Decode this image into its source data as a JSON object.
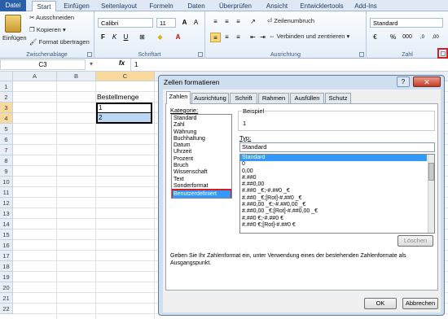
{
  "tabs": [
    "Datei",
    "Start",
    "Einfügen",
    "Seitenlayout",
    "Formeln",
    "Daten",
    "Überprüfen",
    "Ansicht",
    "Entwicklertools",
    "Add-Ins"
  ],
  "ribbon": {
    "clipboard": {
      "paste": "Einfügen",
      "cut": "Ausschneiden",
      "copy": "Kopieren",
      "format_painter": "Format übertragen",
      "label": "Zwischenablage"
    },
    "font": {
      "name": "Calibri",
      "size": "11",
      "bold": "F",
      "italic": "K",
      "underline": "U",
      "label": "Schriftart"
    },
    "alignment": {
      "wrap": "Zeilenumbruch",
      "merge": "Verbinden und zentrieren",
      "label": "Ausrichtung"
    },
    "number": {
      "format": "Standard",
      "percent": "%",
      "thousands": "000",
      "label": "Zahl"
    }
  },
  "formula_bar": {
    "name_box": "C3",
    "fx": "fx",
    "value": "1"
  },
  "sheet": {
    "columns": [
      "A",
      "B",
      "C"
    ],
    "rows": [
      "1",
      "2",
      "3",
      "4",
      "5",
      "6",
      "7",
      "8",
      "9",
      "10",
      "11",
      "12",
      "13",
      "14",
      "15",
      "16",
      "17",
      "18",
      "19",
      "20",
      "21",
      "22"
    ],
    "cells": {
      "C2": "Bestellmenge",
      "C3": "1",
      "C4": "2"
    }
  },
  "dialog": {
    "title": "Zellen formatieren",
    "help": "?",
    "close": "✕",
    "tabs": [
      "Zahlen",
      "Ausrichtung",
      "Schrift",
      "Rahmen",
      "Ausfüllen",
      "Schutz"
    ],
    "category_label": "Kategorie:",
    "categories": [
      "Standard",
      "Zahl",
      "Währung",
      "Buchhaltung",
      "Datum",
      "Uhrzeit",
      "Prozent",
      "Bruch",
      "Wissenschaft",
      "Text",
      "Sonderformat",
      "Benutzerdefiniert"
    ],
    "selected_category": "Benutzerdefiniert",
    "sample_label": "Beispiel",
    "sample_value": "1",
    "type_label": "Typ:",
    "type_value": "Standard",
    "types": [
      "Standard",
      "0",
      "0,00",
      "#.##0",
      "#.##0,00",
      "#.##0 _€;-#.##0 _€",
      "#.##0 _€;[Rot]-#.##0 _€",
      "#.##0,00 _€;-#.##0,00 _€",
      "#.##0,00 _€;[Rot]-#.##0,00 _€",
      "#.##0 €;-#.##0 €",
      "#.##0 €;[Rot]-#.##0 €"
    ],
    "delete_button": "Löschen",
    "description": "Geben Sie Ihr Zahlenformat ein, unter Verwendung eines der bestehenden Zahlenformate als Ausgangspunkt.",
    "ok": "OK",
    "cancel": "Abbrechen"
  },
  "colors": {
    "highlight": "#d61c1c",
    "selection": "#3399ff",
    "accent": "#2a5ea8"
  }
}
